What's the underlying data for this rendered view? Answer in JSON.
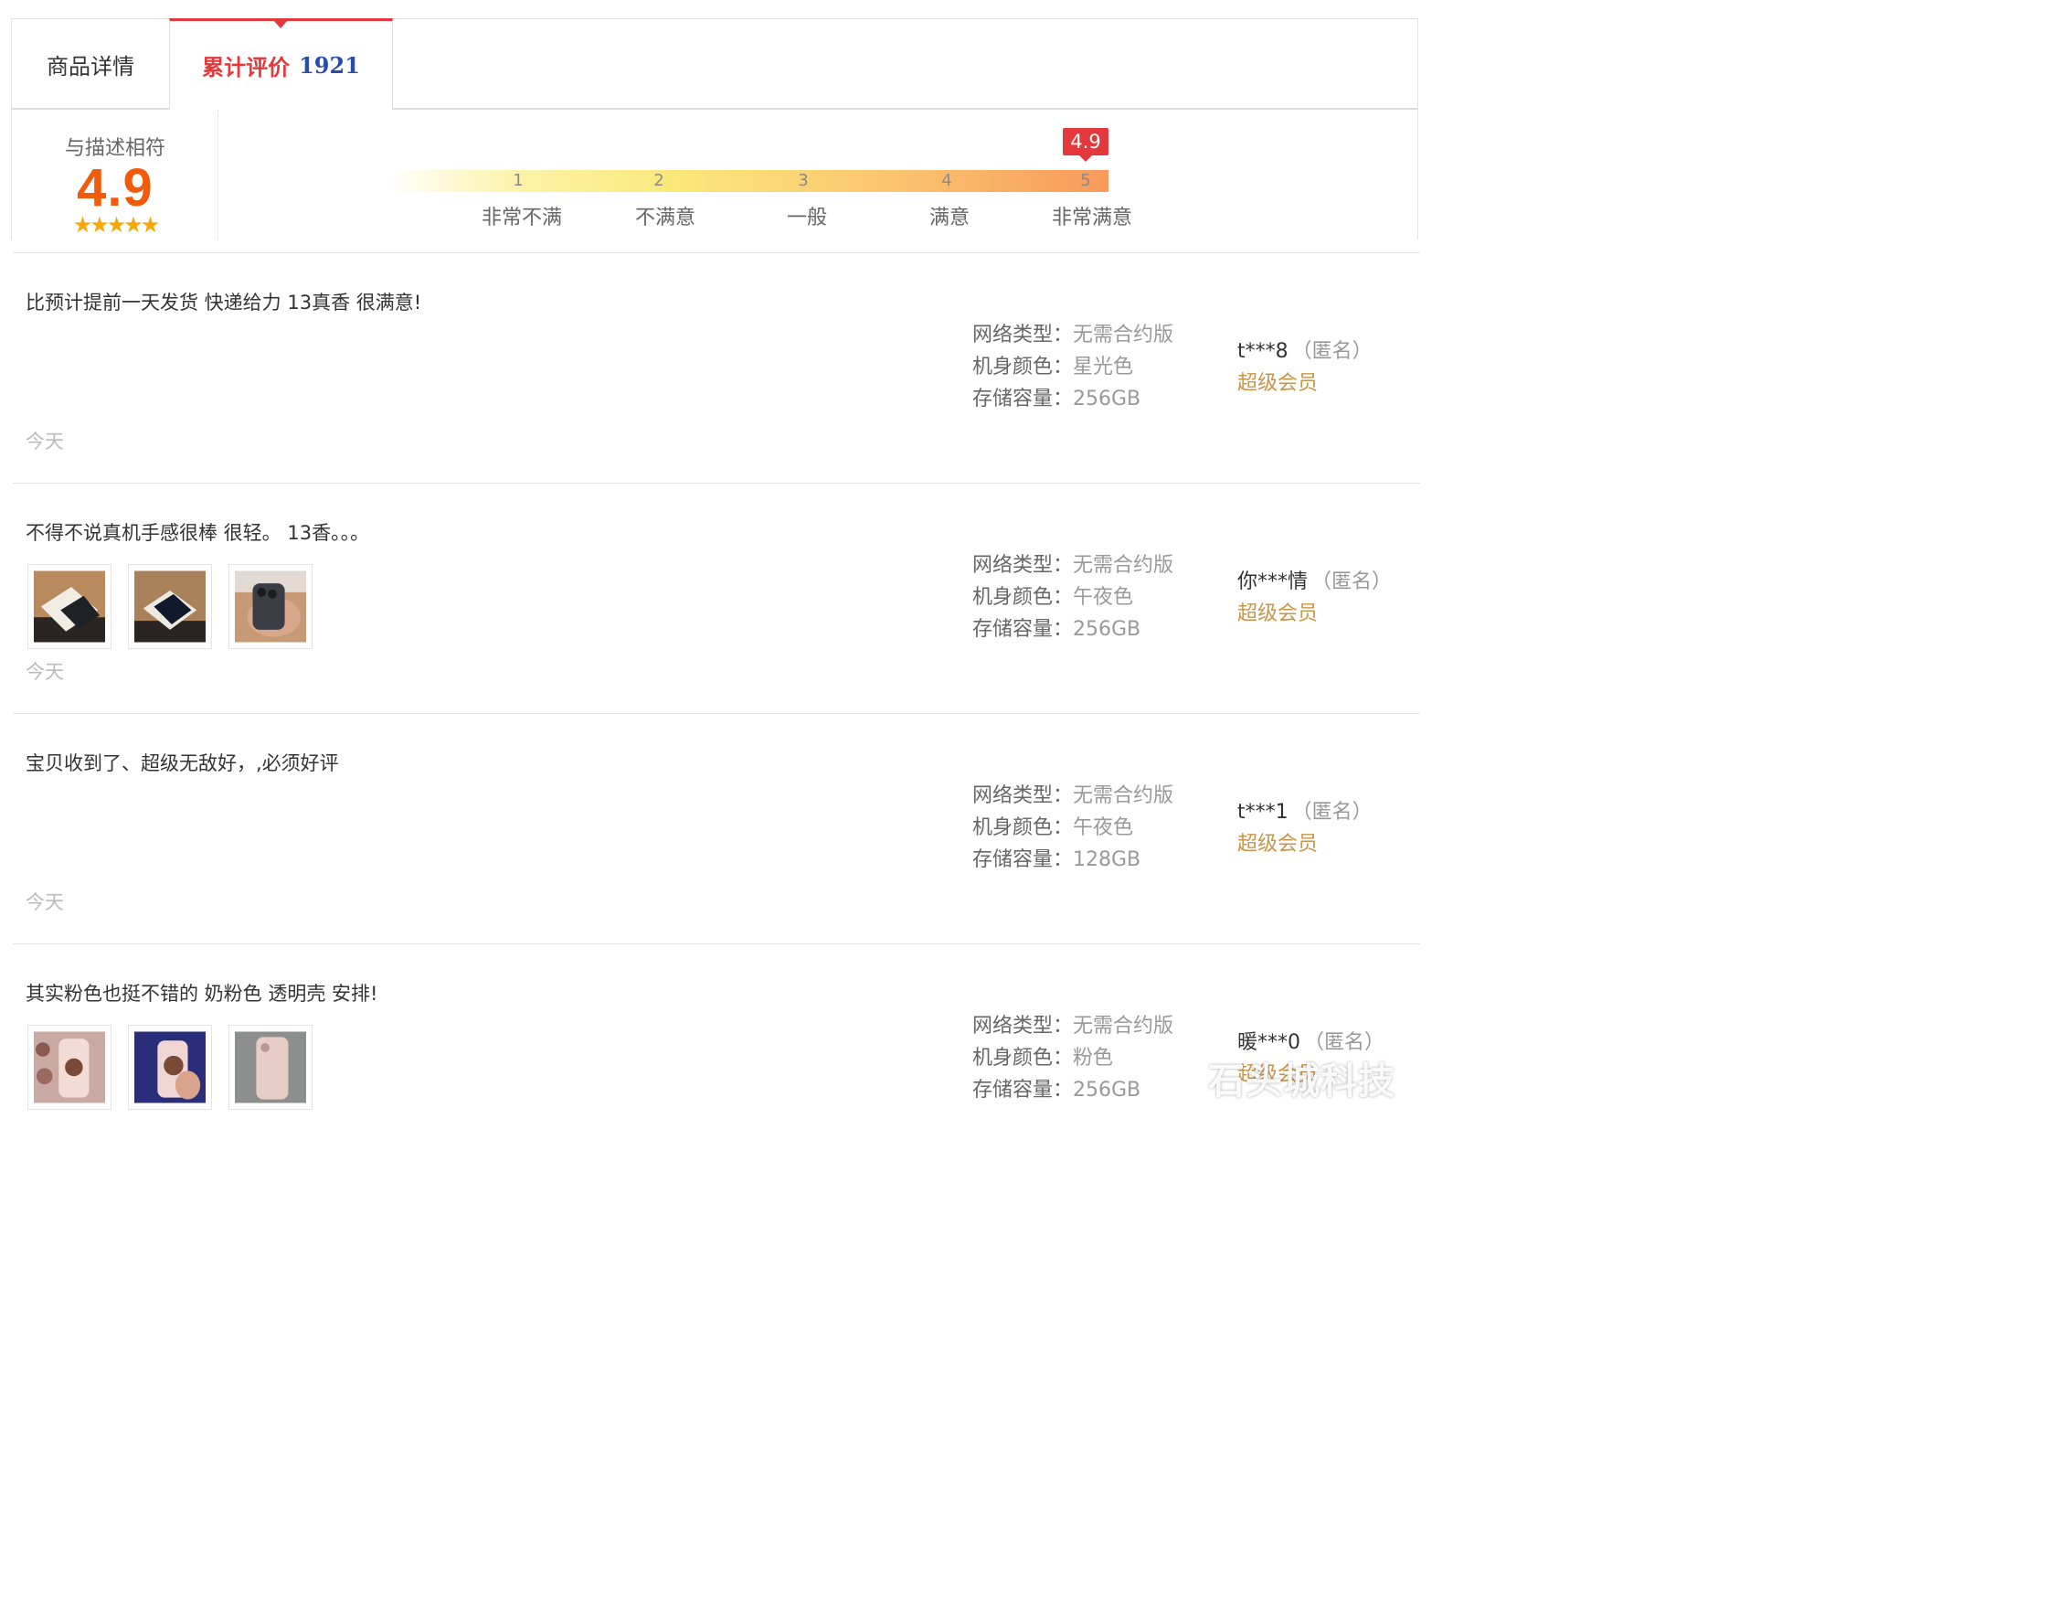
{
  "tabs": {
    "details_label": "商品详情",
    "reviews_label": "累计评价",
    "reviews_count": "1921"
  },
  "summary": {
    "title": "与描述相符",
    "score": "4.9",
    "stars": "★★★★★",
    "marker": "4.9",
    "scale": [
      {
        "num": "1",
        "label": "非常不满"
      },
      {
        "num": "2",
        "label": "不满意"
      },
      {
        "num": "3",
        "label": "一般"
      },
      {
        "num": "4",
        "label": "满意"
      },
      {
        "num": "5",
        "label": "非常满意"
      }
    ]
  },
  "reviews": [
    {
      "text": "比预计提前一天发货 快递给力 13真香 很满意!",
      "date": "今天",
      "specs": [
        {
          "key": "网络类型：",
          "value": "无需合约版"
        },
        {
          "key": "机身颜色：",
          "value": "星光色"
        },
        {
          "key": "存储容量：",
          "value": "256GB"
        }
      ],
      "user": "t***8",
      "anon": "（匿名）",
      "level": "超级会员"
    },
    {
      "text": "不得不说真机手感很棒 很轻。 13香。。。",
      "date": "今天",
      "specs": [
        {
          "key": "网络类型：",
          "value": "无需合约版"
        },
        {
          "key": "机身颜色：",
          "value": "午夜色"
        },
        {
          "key": "存储容量：",
          "value": "256GB"
        }
      ],
      "user": "你***情",
      "anon": "（匿名）",
      "level": "超级会员"
    },
    {
      "text": "宝贝收到了、超级无敌好，,必须好评",
      "date": "今天",
      "specs": [
        {
          "key": "网络类型：",
          "value": "无需合约版"
        },
        {
          "key": "机身颜色：",
          "value": "午夜色"
        },
        {
          "key": "存储容量：",
          "value": "128GB"
        }
      ],
      "user": "t***1",
      "anon": "（匿名）",
      "level": "超级会员"
    },
    {
      "text": "其实粉色也挺不错的 奶粉色 透明壳 安排!",
      "specs": [
        {
          "key": "网络类型：",
          "value": "无需合约版"
        },
        {
          "key": "机身颜色：",
          "value": "粉色"
        },
        {
          "key": "存储容量：",
          "value": "256GB"
        }
      ],
      "user": "暖***0",
      "anon": "（匿名）",
      "level": "超级会员"
    }
  ],
  "watermark": "石头城科技",
  "colors": {
    "accent_red": "#e4393c",
    "score_orange": "#f25a0c",
    "count_blue": "#2a4ea6",
    "member_gold": "#c99647"
  }
}
